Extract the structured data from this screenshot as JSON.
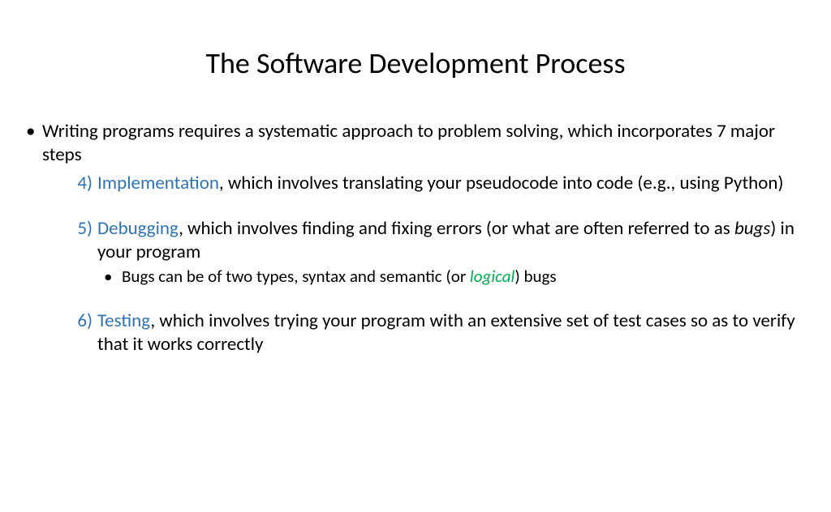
{
  "title": "The Software Development Process",
  "intro": "Writing programs requires a systematic approach to problem solving, which incorporates 7 major steps",
  "step4": {
    "num": "4)",
    "term": "Implementation",
    "rest": ", which involves translating your pseudocode into code (e.g., using Python)"
  },
  "step5": {
    "num": "5)",
    "term": "Debugging",
    "rest_a": ", which involves finding and fixing errors (or what are often referred to as ",
    "bugs": "bugs",
    "rest_b": ") in your program",
    "sub_a": "Bugs can be of two types, syntax and semantic (or ",
    "logical": "logical",
    "sub_b": ") bugs"
  },
  "step6": {
    "num": "6)",
    "term": "Testing",
    "rest": ", which involves trying your program with an extensive set of test cases so as to verify that it works correctly"
  }
}
